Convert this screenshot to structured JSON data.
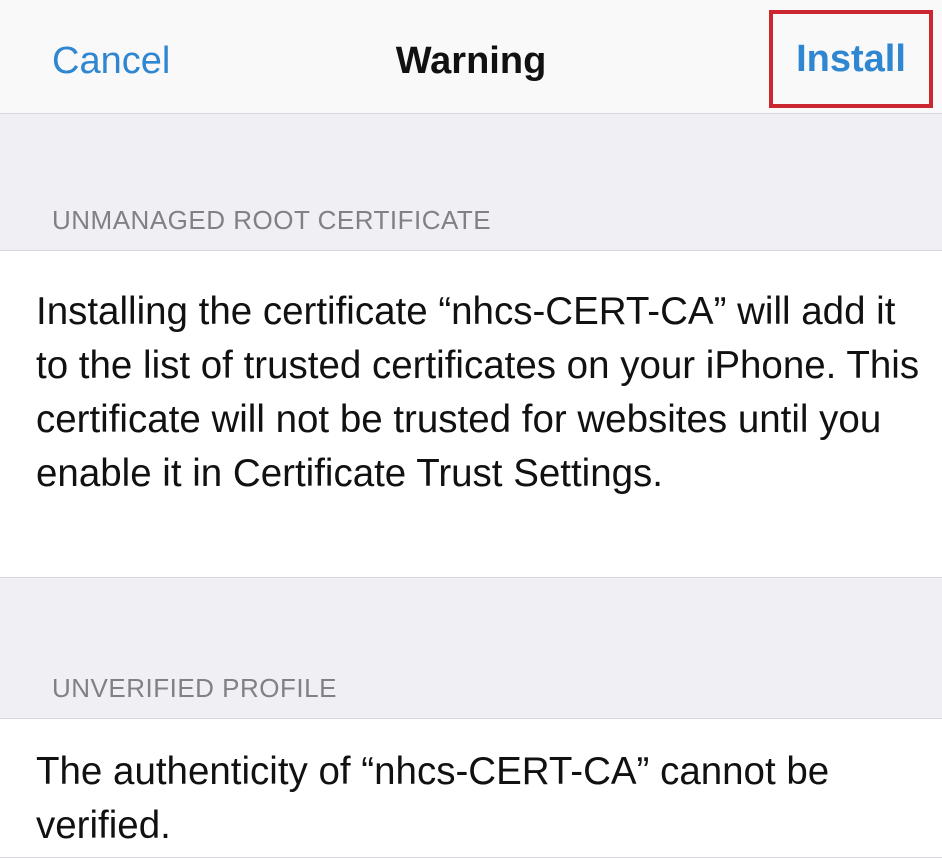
{
  "nav": {
    "cancel_label": "Cancel",
    "title": "Warning",
    "install_label": "Install",
    "install_highlight_color": "#cc2630"
  },
  "sections": [
    {
      "header": "UNMANAGED ROOT CERTIFICATE",
      "body": "Installing the certificate “nhcs-CERT-CA” will add it to the list of trusted certificates on your iPhone. This certificate will not be trusted for websites until you enable it in Certificate Trust Settings."
    },
    {
      "header": "UNVERIFIED PROFILE",
      "body": "The authenticity of “nhcs-CERT-CA” cannot be verified."
    }
  ],
  "colors": {
    "accent": "#2f86d1",
    "background": "#efeff4",
    "header_text": "#808086"
  }
}
